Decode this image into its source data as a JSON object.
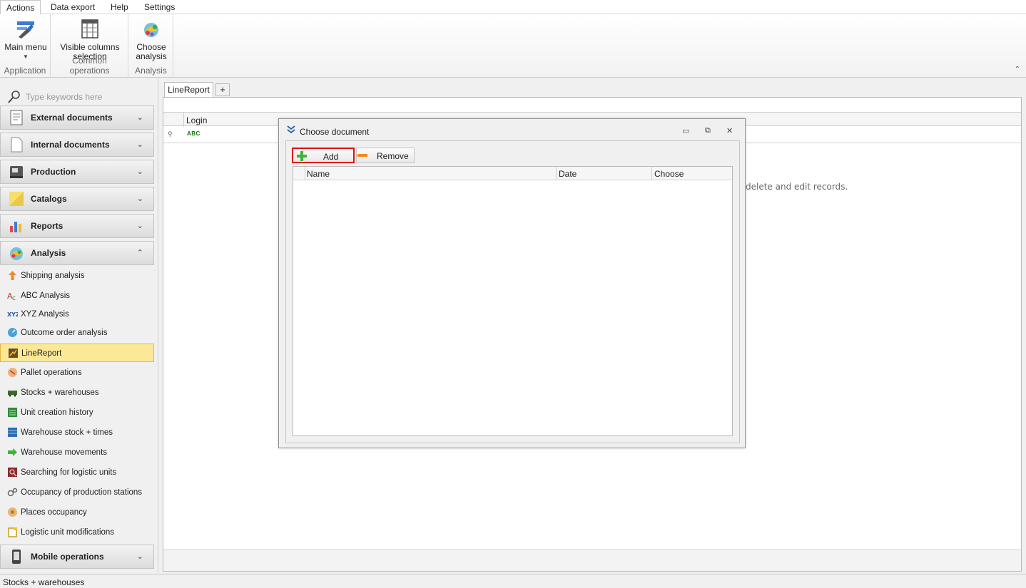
{
  "menu": {
    "tabs": [
      "Actions",
      "Data export",
      "Help",
      "Settings"
    ]
  },
  "ribbon": {
    "groups": [
      {
        "label": "Application",
        "buttons": [
          {
            "label_1": "Main menu",
            "label_2": "",
            "icon": "main-menu-icon"
          }
        ]
      },
      {
        "label": "Common operations",
        "buttons": [
          {
            "label_1": "Visible columns",
            "label_2": "selection",
            "icon": "columns-icon"
          }
        ]
      },
      {
        "label": "Analysis",
        "buttons": [
          {
            "label_1": "Choose",
            "label_2": "analysis",
            "icon": "analysis-icon"
          }
        ]
      }
    ]
  },
  "sidebar": {
    "search_placeholder": "Type keywords here",
    "sections": [
      {
        "label": "External documents",
        "icon": "external-documents-icon"
      },
      {
        "label": "Internal documents",
        "icon": "internal-documents-icon"
      },
      {
        "label": "Production",
        "icon": "production-icon"
      },
      {
        "label": "Catalogs",
        "icon": "catalogs-icon"
      },
      {
        "label": "Reports",
        "icon": "reports-icon"
      },
      {
        "label": "Analysis",
        "icon": "analysis-icon"
      }
    ],
    "analysis_items": [
      {
        "label": "Shipping analysis",
        "icon": "shipping-arrow-icon"
      },
      {
        "label": "ABC Analysis",
        "icon": "abc-icon"
      },
      {
        "label": "XYZ Analysis",
        "icon": "xyz-icon"
      },
      {
        "label": "Outcome order analysis",
        "icon": "gauge-icon"
      },
      {
        "label": "LineReport",
        "icon": "line-report-icon"
      },
      {
        "label": "Pallet operations",
        "icon": "pallet-icon"
      },
      {
        "label": "Stocks + warehouses",
        "icon": "stocks-icon"
      },
      {
        "label": "Unit creation history",
        "icon": "unit-history-icon"
      },
      {
        "label": "Warehouse stock + times",
        "icon": "warehouse-stock-icon"
      },
      {
        "label": "Warehouse movements",
        "icon": "movement-arrow-icon"
      },
      {
        "label": "Searching for logistic units",
        "icon": "search-units-icon"
      },
      {
        "label": "Occupancy of production stations",
        "icon": "gears-icon"
      },
      {
        "label": "Places occupancy",
        "icon": "places-icon"
      },
      {
        "label": "Logistic unit modifications",
        "icon": "modify-icon"
      }
    ],
    "bottom_section": {
      "label": "Mobile operations",
      "icon": "mobile-icon"
    }
  },
  "main": {
    "tab_label": "LineReport",
    "add_tab": "+",
    "grid_column": "Login",
    "hint_text": "delete and edit records."
  },
  "dialog": {
    "title": "Choose document",
    "add_label": "Add",
    "remove_label": "Remove",
    "columns": [
      "Name",
      "Date",
      "Choose"
    ]
  },
  "status": {
    "text": "Stocks + warehouses"
  },
  "colors": {
    "selected_bg": "#fce997",
    "selected_border": "#e6b740",
    "highlight_red": "#e01010",
    "accent_blue": "#2a5ea8"
  }
}
